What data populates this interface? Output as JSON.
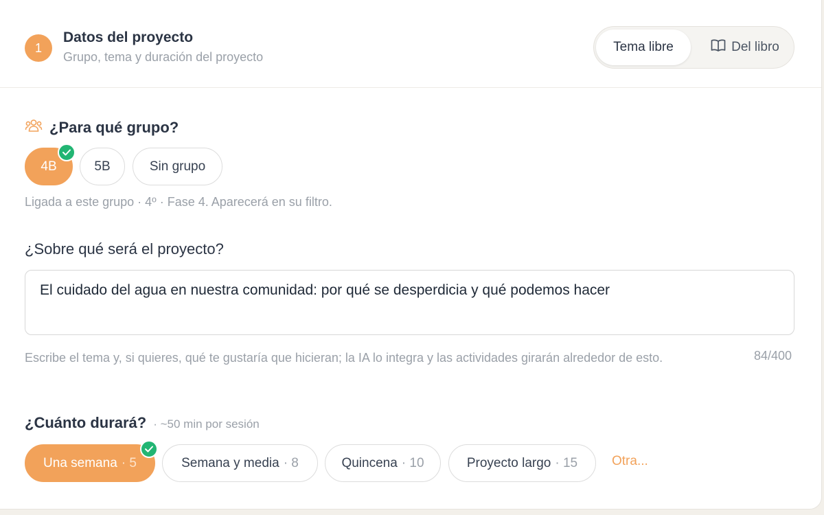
{
  "header": {
    "step_number": "1",
    "title": "Datos del proyecto",
    "subtitle": "Grupo, tema y duración del proyecto",
    "mode_options": [
      "Tema libre",
      "Del libro"
    ],
    "mode_selected": "Tema libre"
  },
  "group": {
    "label": "¿Para qué grupo?",
    "options": [
      "4B",
      "5B",
      "Sin grupo"
    ],
    "selected": "4B",
    "hint": "Ligada a este grupo · 4º · Fase 4. Aparecerá en su filtro."
  },
  "topic": {
    "label": "¿Sobre qué será el proyecto?",
    "value": "El cuidado del agua en nuestra comunidad: por qué se desperdicia y qué podemos hacer",
    "help": "Escribe el tema y, si quieres, qué te gustaría que hicieran; la IA lo integra y las actividades girarán alrededor de esto.",
    "counter": "84/400"
  },
  "duration": {
    "label": "¿Cuánto durará?",
    "sublabel": "· ~50 min por sesión",
    "options": [
      {
        "label": "Una semana",
        "count": "· 5"
      },
      {
        "label": "Semana y media",
        "count": "· 8"
      },
      {
        "label": "Quincena",
        "count": "· 10"
      },
      {
        "label": "Proyecto largo",
        "count": "· 15"
      }
    ],
    "selected": "Una semana",
    "other_label": "Otra..."
  },
  "colors": {
    "accent": "#f2a25a",
    "check": "#22b573",
    "muted_text": "#9aa0a8",
    "heading_text": "#2b3444"
  },
  "icons": [
    "group-icon",
    "book-icon",
    "check-icon"
  ]
}
